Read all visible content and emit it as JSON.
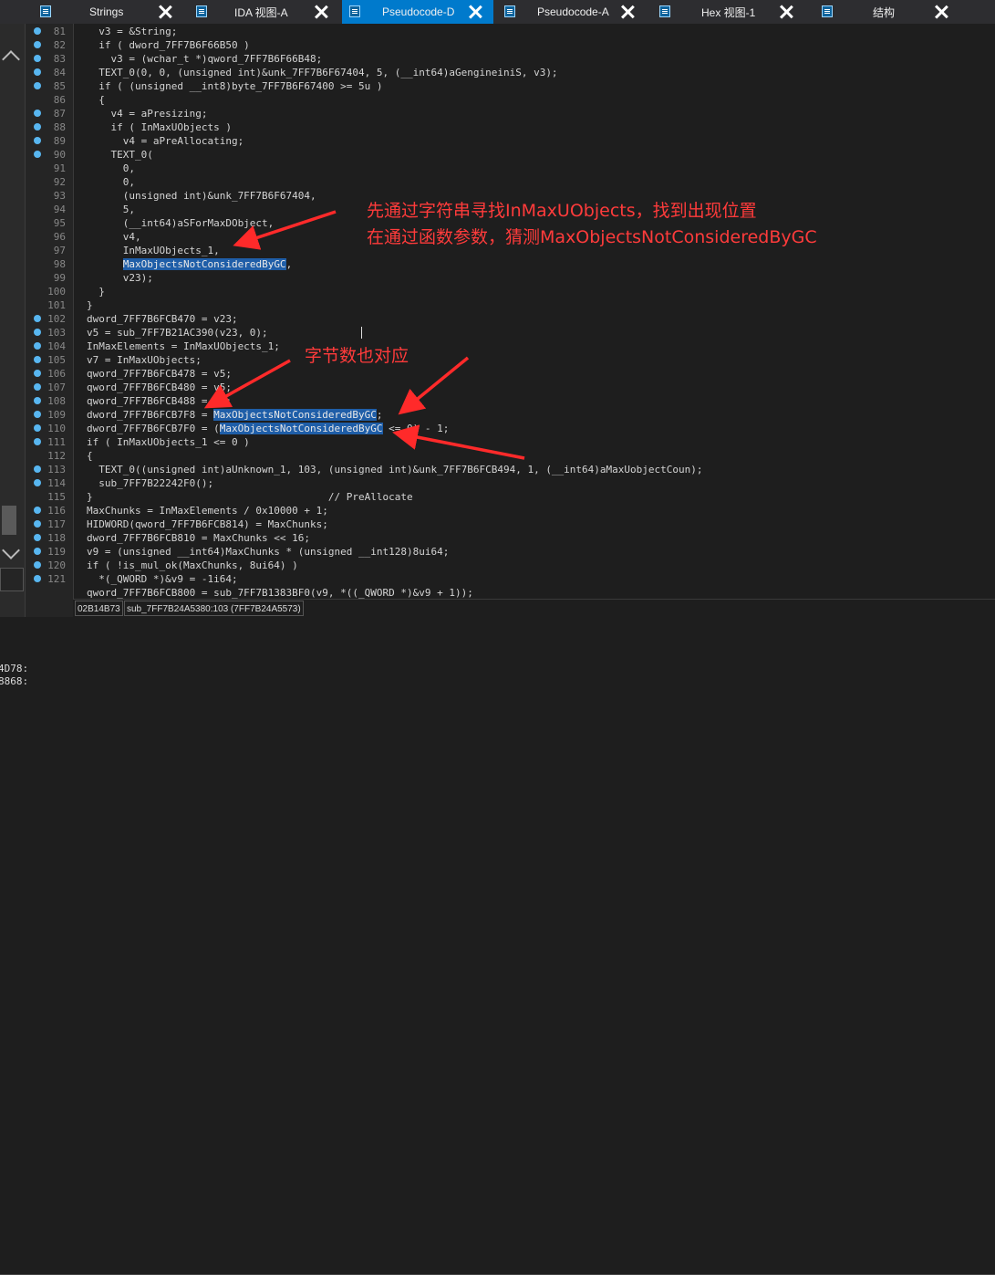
{
  "tabs": [
    {
      "label": "Strings",
      "active": false
    },
    {
      "label": "IDA 视图-A",
      "active": false
    },
    {
      "label": "Pseudocode-D",
      "active": true
    },
    {
      "label": "Pseudocode-A",
      "active": false
    },
    {
      "label": "Hex 视图-1",
      "active": false
    },
    {
      "label": "结构",
      "active": false
    }
  ],
  "code_lines": [
    {
      "ln": "81",
      "bp": true,
      "text": "  v3 = &String;"
    },
    {
      "ln": "82",
      "bp": true,
      "text": "  if ( dword_7FF7B6F66B50 )"
    },
    {
      "ln": "83",
      "bp": true,
      "text": "    v3 = (wchar_t *)qword_7FF7B6F66B48;"
    },
    {
      "ln": "84",
      "bp": true,
      "text": "  TEXT_0(0, 0, (unsigned int)&unk_7FF7B6F67404, 5, (__int64)aGengineiniS, v3);"
    },
    {
      "ln": "85",
      "bp": true,
      "text": "  if ( (unsigned __int8)byte_7FF7B6F67400 >= 5u )"
    },
    {
      "ln": "86",
      "bp": false,
      "text": "  {"
    },
    {
      "ln": "87",
      "bp": true,
      "text": "    v4 = aPresizing;"
    },
    {
      "ln": "88",
      "bp": true,
      "text": "    if ( InMaxUObjects )"
    },
    {
      "ln": "89",
      "bp": true,
      "text": "      v4 = aPreAllocating;"
    },
    {
      "ln": "90",
      "bp": true,
      "text": "    TEXT_0("
    },
    {
      "ln": "91",
      "bp": false,
      "text": "      0,"
    },
    {
      "ln": "92",
      "bp": false,
      "text": "      0,"
    },
    {
      "ln": "93",
      "bp": false,
      "text": "      (unsigned int)&unk_7FF7B6F67404,"
    },
    {
      "ln": "94",
      "bp": false,
      "text": "      5,"
    },
    {
      "ln": "95",
      "bp": false,
      "text": "      (__int64)aSForMaxDObject,"
    },
    {
      "ln": "96",
      "bp": false,
      "text": "      v4,"
    },
    {
      "ln": "97",
      "bp": false,
      "text": "      InMaxUObjects_1,"
    },
    {
      "ln": "98",
      "bp": false,
      "text": "      MaxObjectsNotConsideredByGC,"
    },
    {
      "ln": "99",
      "bp": false,
      "text": "      v23);"
    },
    {
      "ln": "100",
      "bp": false,
      "text": "  }"
    },
    {
      "ln": "101",
      "bp": false,
      "text": "}"
    },
    {
      "ln": "102",
      "bp": true,
      "text": "dword_7FF7B6FCB470 = v23;"
    },
    {
      "ln": "103",
      "bp": true,
      "text": "v5 = sub_7FF7B21AC390(v23, 0);"
    },
    {
      "ln": "104",
      "bp": true,
      "text": "InMaxElements = InMaxUObjects_1;"
    },
    {
      "ln": "105",
      "bp": true,
      "text": "v7 = InMaxUObjects;"
    },
    {
      "ln": "106",
      "bp": true,
      "text": "qword_7FF7B6FCB478 = v5;"
    },
    {
      "ln": "107",
      "bp": true,
      "text": "qword_7FF7B6FCB480 = v5;"
    },
    {
      "ln": "108",
      "bp": true,
      "text": "qword_7FF7B6FCB488 = v5;"
    },
    {
      "ln": "109",
      "bp": true,
      "text": "dword_7FF7B6FCB7F8 = MaxObjectsNotConsideredByGC;"
    },
    {
      "ln": "110",
      "bp": true,
      "text": "dword_7FF7B6FCB7F0 = (MaxObjectsNotConsideredByGC <= 0) - 1;"
    },
    {
      "ln": "111",
      "bp": true,
      "text": "if ( InMaxUObjects_1 <= 0 )"
    },
    {
      "ln": "112",
      "bp": false,
      "text": "{"
    },
    {
      "ln": "113",
      "bp": true,
      "text": "  TEXT_0((unsigned int)aUnknown_1, 103, (unsigned int)&unk_7FF7B6FCB494, 1, (__int64)aMaxUobjectCoun);"
    },
    {
      "ln": "114",
      "bp": true,
      "text": "  sub_7FF7B22242F0();"
    },
    {
      "ln": "115",
      "bp": false,
      "text": "}                                       // PreAllocate"
    },
    {
      "ln": "116",
      "bp": true,
      "text": "MaxChunks = InMaxElements / 0x10000 + 1;"
    },
    {
      "ln": "117",
      "bp": true,
      "text": "HIDWORD(qword_7FF7B6FCB814) = MaxChunks;"
    },
    {
      "ln": "118",
      "bp": true,
      "text": "dword_7FF7B6FCB810 = MaxChunks << 16;"
    },
    {
      "ln": "119",
      "bp": true,
      "text": "v9 = (unsigned __int64)MaxChunks * (unsigned __int128)8ui64;"
    },
    {
      "ln": "120",
      "bp": true,
      "text": "if ( !is_mul_ok(MaxChunks, 8ui64) )"
    },
    {
      "ln": "121",
      "bp": true,
      "text": "  *(_QWORD *)&v9 = -1i64;"
    },
    {
      "ln": "",
      "bp": false,
      "text": "qword_7FF7B6FCB800 = sub_7FF7B1383BF0(v9, *((_QWORD *)&v9 + 1));"
    }
  ],
  "highlight_word": "MaxObjectsNotConsideredByGC",
  "status": {
    "address": "02B14B73",
    "location": "sub_7FF7B24A5380:103 (7FF7B24A5573)"
  },
  "bottom_lines": [
    "4D78:",
    "8868:"
  ],
  "annotations": {
    "line1": "先通过字符串寻找InMaxUObjects，找到出现位置",
    "line2": "在通过函数参数，猜测MaxObjectsNotConsideredByGC",
    "line3": "字节数也对应"
  },
  "colors": {
    "accent": "#007acc",
    "breakpoint": "#58b6f0",
    "annotation": "#ff3b3b",
    "selection": "#1f5ea8"
  }
}
